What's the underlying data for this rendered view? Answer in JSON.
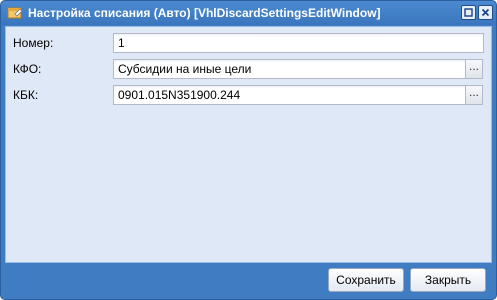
{
  "window": {
    "title": "Настройка списания (Авто) [VhlDiscardSettingsEditWindow]",
    "icon": "window-settings-icon",
    "controls": [
      "maximize-icon",
      "close-icon"
    ]
  },
  "form": {
    "number": {
      "label": "Номер:",
      "value": "1"
    },
    "kfo": {
      "label": "КФО:",
      "value": "Субсидии на иные цели",
      "trigger_label": "..."
    },
    "kbk": {
      "label": "КБК:",
      "value": "0901.015N351900.244",
      "trigger_label": "..."
    }
  },
  "footer": {
    "save_label": "Сохранить",
    "close_label": "Закрыть"
  }
}
